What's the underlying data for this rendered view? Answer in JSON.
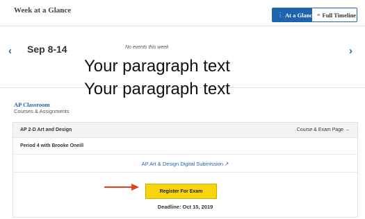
{
  "header": {
    "title": "Week at a Glance",
    "view_toggle": {
      "at_a_glance_icon": "⋮",
      "at_a_glance": "At a Glance",
      "full_timeline_icon": "≡",
      "full_timeline": "Full Timeline"
    }
  },
  "week_nav": {
    "prev_icon": "‹",
    "label": "Sep 8-14",
    "no_events": "No events this week",
    "next_icon": "›"
  },
  "overlay": {
    "line1": "Your paragraph text",
    "line2": "Your paragraph text"
  },
  "ap_classroom": {
    "title": "AP Classroom",
    "subtitle": "Courses & Assignments"
  },
  "course_card": {
    "course_name": "AP 2-D Art and Design",
    "course_link": "Course & Exam Page →",
    "period": "Period 4 with Brooke Oneill",
    "submission_link": "AP Art & Design Digital Submission ↗",
    "register_button": "Register For Exam",
    "deadline": "Deadline: Oct 15, 2019"
  },
  "colors": {
    "accent": "#1e63ad",
    "register": "#f8d40a",
    "annotation_arrow": "#e8401c"
  }
}
